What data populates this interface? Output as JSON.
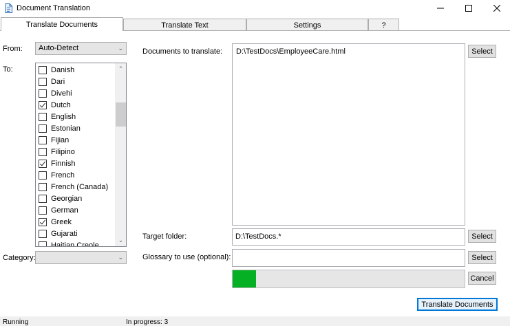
{
  "window": {
    "title": "Document Translation",
    "minimize_glyph": "—",
    "maximize_glyph": "☐",
    "close_glyph": "✕"
  },
  "tabs": [
    {
      "label": "Translate Documents",
      "active": true
    },
    {
      "label": "Translate Text",
      "active": false
    },
    {
      "label": "Settings",
      "active": false
    },
    {
      "label": "?",
      "active": false
    }
  ],
  "from": {
    "label": "From:",
    "value": "Auto-Detect"
  },
  "to": {
    "label": "To:",
    "languages": [
      {
        "name": "Danish",
        "checked": false
      },
      {
        "name": "Dari",
        "checked": false
      },
      {
        "name": "Divehi",
        "checked": false
      },
      {
        "name": "Dutch",
        "checked": true
      },
      {
        "name": "English",
        "checked": false
      },
      {
        "name": "Estonian",
        "checked": false
      },
      {
        "name": "Fijian",
        "checked": false
      },
      {
        "name": "Filipino",
        "checked": false
      },
      {
        "name": "Finnish",
        "checked": true
      },
      {
        "name": "French",
        "checked": false
      },
      {
        "name": "French (Canada)",
        "checked": false
      },
      {
        "name": "Georgian",
        "checked": false
      },
      {
        "name": "German",
        "checked": false
      },
      {
        "name": "Greek",
        "checked": true
      },
      {
        "name": "Gujarati",
        "checked": false
      },
      {
        "name": "Haitian Creole",
        "checked": false
      }
    ]
  },
  "category": {
    "label": "Category:",
    "value": ""
  },
  "documents": {
    "label": "Documents to translate:",
    "value": "D:\\TestDocs\\EmployeeCare.html",
    "select_label": "Select"
  },
  "target": {
    "label": "Target folder:",
    "value": "D:\\TestDocs.*",
    "select_label": "Select"
  },
  "glossary": {
    "label": "Glossary to use (optional):",
    "value": "",
    "select_label": "Select"
  },
  "progress": {
    "fraction": 0.1
  },
  "cancel_label": "Cancel",
  "translate_label": "Translate Documents",
  "status": {
    "left": "Running",
    "right": "In progress: 3"
  },
  "colors": {
    "progress": "#06b025",
    "accent": "#0078d7"
  }
}
